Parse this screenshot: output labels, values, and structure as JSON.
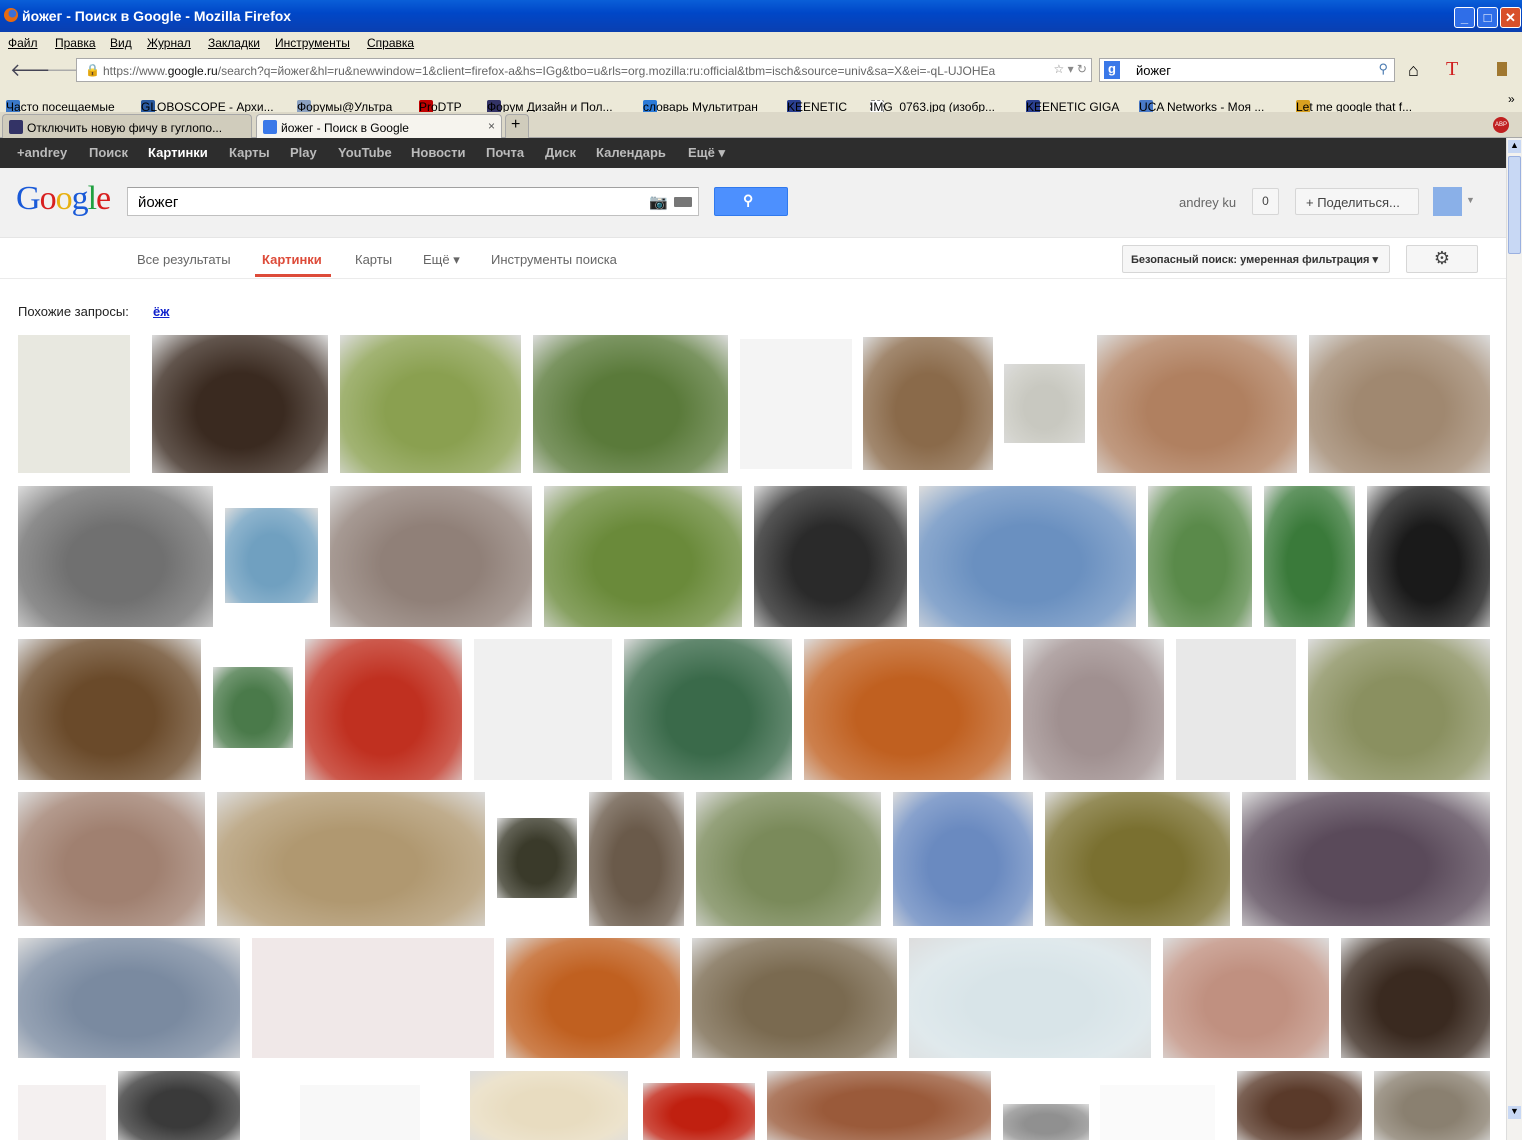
{
  "window": {
    "title": "йожег - Поиск в Google - Mozilla Firefox"
  },
  "menu": [
    "Файл",
    "Правка",
    "Вид",
    "Журнал",
    "Закладки",
    "Инструменты",
    "Справка"
  ],
  "nav": {
    "url_prefix": "https://www.",
    "url_host": "google.ru",
    "url_rest": "/search?q=йожег&hl=ru&newwindow=1&client=firefox-a&hs=IGg&tbo=u&rls=org.mozilla:ru:official&tbm=isch&source=univ&sa=X&ei=-qL-UJOHEa",
    "search_value": "йожег"
  },
  "bookmarks": [
    {
      "label": "Часто посещаемые",
      "color": "#3a78c8"
    },
    {
      "label": "GLOBOSCOPE - Архи...",
      "color": "#2a5aa0"
    },
    {
      "label": "Форумы@Ультра",
      "color": "#8aa0c0"
    },
    {
      "label": "ProDTP",
      "color": "#c00000"
    },
    {
      "label": "Форум Дизайн и Пол...",
      "color": "#333366"
    },
    {
      "label": "словарь Мультитран",
      "color": "#2a7ad8"
    },
    {
      "label": "KEENETIC",
      "color": "#2a3f90"
    },
    {
      "label": "IMG_0763.jpg (изобр...",
      "color": "#ffffff"
    },
    {
      "label": "KEENETIC GIGA",
      "color": "#2a3f90"
    },
    {
      "label": "UCA Networks - Моя ...",
      "color": "#4a7ac8"
    },
    {
      "label": "Let me google that f...",
      "color": "#d8a020"
    }
  ],
  "tabs": [
    {
      "label": "Отключить новую фичу в гуглопо..."
    },
    {
      "label": "йожег - Поиск в Google"
    }
  ],
  "gbar": [
    "+andrey",
    "Поиск",
    "Картинки",
    "Карты",
    "Play",
    "YouTube",
    "Новости",
    "Почта",
    "Диск",
    "Календарь",
    "Ещё ▾"
  ],
  "google": {
    "query": "йожег",
    "user": "andrey ku",
    "count": "0",
    "share": "+ Поделиться..."
  },
  "toolsbar": {
    "items": [
      "Все результаты",
      "Картинки",
      "Карты",
      "Ещё ▾",
      "Инструменты поиска"
    ],
    "safe": "Безопасный поиск: умеренная фильтрация ▾"
  },
  "related": {
    "label": "Похожие запросы:",
    "link": "ёж"
  },
  "thumb_colors": [
    [
      "#e8e8e0",
      "#3a2a20",
      "#8aa050",
      "#5a7a3a",
      "#f4f4f4",
      "#8a6a4a",
      "#c8c8c0",
      "#b08060",
      "#a08870"
    ],
    [
      "#707070",
      "#70a0c0",
      "#908078",
      "#6a8a3a",
      "#2a2a2a",
      "#6a90c0",
      "#5a8a4a",
      "#3a7a3a",
      "#1a1a1a"
    ],
    [
      "#6a4a2a",
      "#4a7a4a",
      "#c03020",
      "#f0f0f0",
      "#3a6a4a",
      "#c06020",
      "#a09090",
      "#e8e8e8",
      "#8a9060"
    ],
    [
      "#a08070",
      "#b09870",
      "#3a3a2a",
      "#6a5a4a",
      "#7a8a5a",
      "#6a8ac0",
      "#7a7030",
      "#5a4a5a"
    ],
    [
      "#7a8aa0",
      "#f0e8e8",
      "#c06020",
      "#7a6a50",
      "#d8e4e8",
      "#c09080",
      "#3a2a20"
    ],
    [
      "#f4f0f0",
      "#3a3a3a",
      "#f8f8f8",
      "#e8dcc0",
      "#c02010",
      "#9a5a3a",
      "#909090",
      "#fafafa",
      "#5a3a2a",
      "#8a8070"
    ]
  ]
}
